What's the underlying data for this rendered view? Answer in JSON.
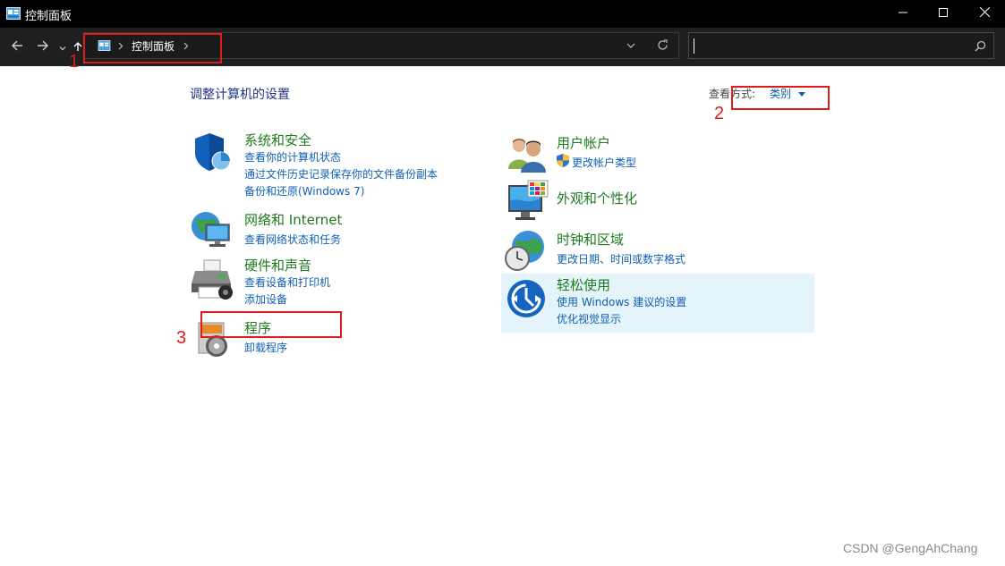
{
  "window": {
    "title": "控制面板",
    "minimize_glyph": "—",
    "maximize_glyph": "☐",
    "close_glyph": "✕"
  },
  "nav": {
    "back_icon": "arrow-left-icon",
    "forward_icon": "arrow-right-icon",
    "recent_icon": "chevron-down-icon",
    "up_icon": "arrow-up-icon",
    "breadcrumb": [
      "控制面板"
    ],
    "refresh_icon": "refresh-icon",
    "search_value": "",
    "search_icon": "search-icon"
  },
  "main": {
    "heading": "调整计算机的设置",
    "view_by_label": "查看方式:",
    "view_by_value": "类别",
    "left_categories": [
      {
        "title": "系统和安全",
        "icon": "shield-icon",
        "links": [
          "查看你的计算机状态",
          "通过文件历史记录保存你的文件备份副本",
          "备份和还原(Windows 7)"
        ]
      },
      {
        "title": "网络和 Internet",
        "icon": "network-globe-icon",
        "links": [
          "查看网络状态和任务"
        ]
      },
      {
        "title": "硬件和声音",
        "icon": "printer-icon",
        "links": [
          "查看设备和打印机",
          "添加设备"
        ]
      },
      {
        "title": "程序",
        "icon": "programs-disc-icon",
        "links": [
          "卸载程序"
        ]
      }
    ],
    "right_categories": [
      {
        "title": "用户帐户",
        "icon": "users-icon",
        "links": [
          "更改帐户类型"
        ]
      },
      {
        "title": "外观和个性化",
        "icon": "monitor-palette-icon",
        "links": []
      },
      {
        "title": "时钟和区域",
        "icon": "clock-globe-icon",
        "links": [
          "更改日期、时间或数字格式"
        ]
      },
      {
        "title": "轻松使用",
        "icon": "ease-of-access-icon",
        "links": [
          "使用 Windows 建议的设置",
          "优化视觉显示"
        ]
      }
    ]
  },
  "annotations": [
    "1",
    "2",
    "3"
  ],
  "watermark": "CSDN @GengAhChang",
  "colors": {
    "title_bar": "#000000",
    "nav_bar": "#1f1f1f",
    "category_title": "#1e7a1e",
    "link": "#0f5fb3",
    "heading": "#1e3287",
    "annotation": "#e01b1b",
    "hover_bg": "#e5f3fb"
  }
}
